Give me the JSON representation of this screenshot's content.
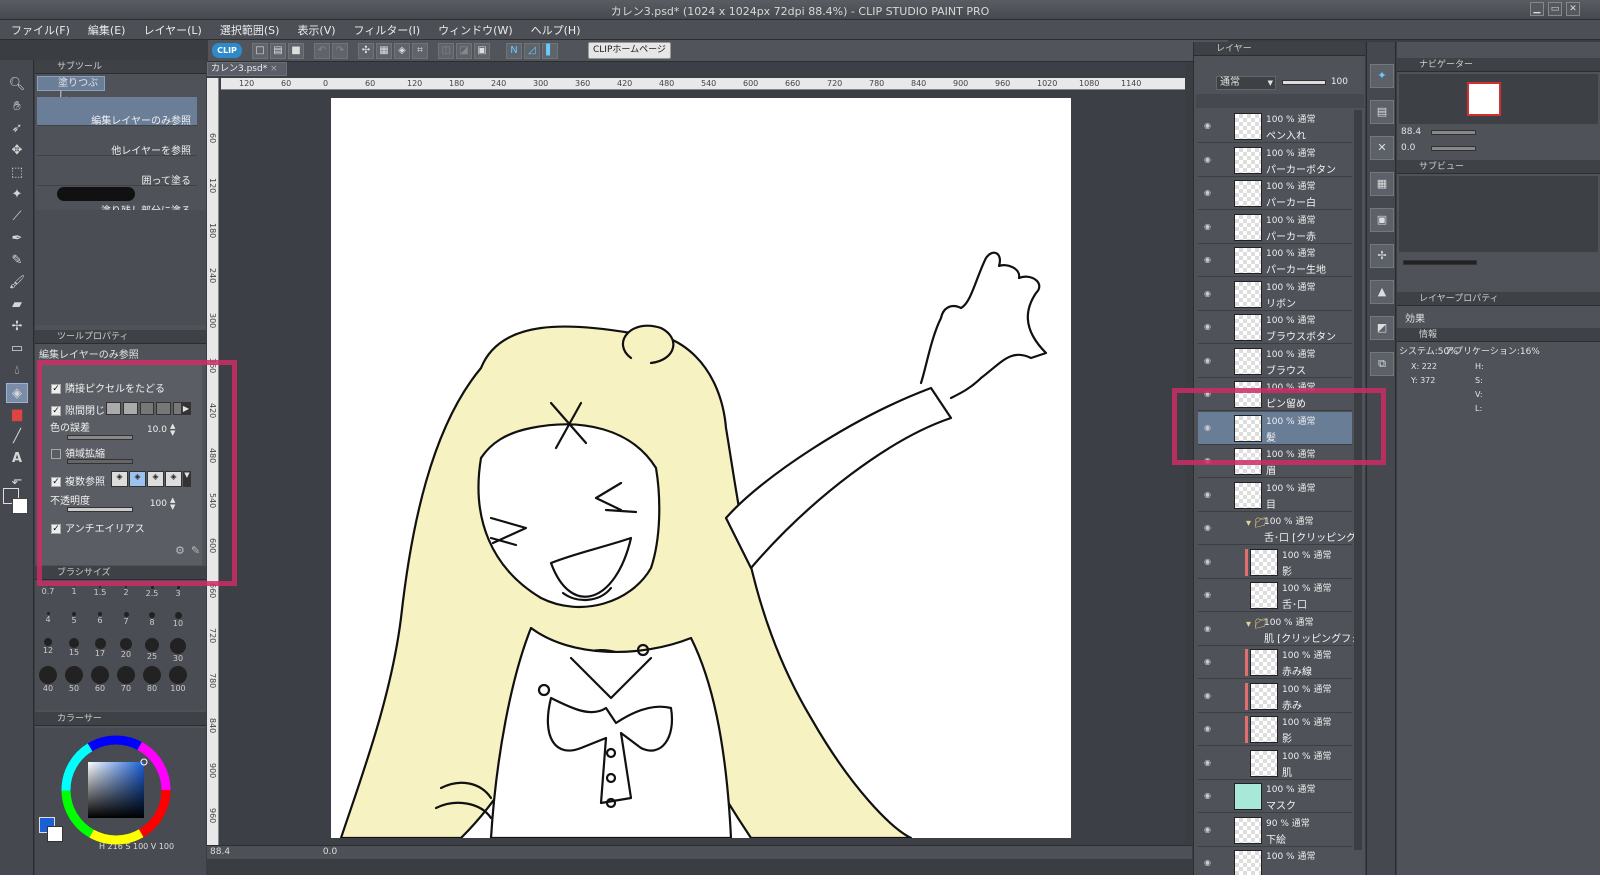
{
  "window": {
    "title": "カレン3.psd* (1024 x 1024px 72dpi 88.4%)  - CLIP STUDIO PAINT PRO"
  },
  "menu": [
    "ファイル(F)",
    "編集(E)",
    "レイヤー(L)",
    "選択範囲(S)",
    "表示(V)",
    "フィルター(I)",
    "ウィンドウ(W)",
    "ヘルプ(H)"
  ],
  "toolbar": {
    "logo": "CLIP",
    "home_button": "CLIPホームページ"
  },
  "subtool": {
    "tab": "サブツール",
    "group_label": "塗りつぶし",
    "items": [
      "編集レイヤーのみ参照",
      "他レイヤーを参照",
      "囲って塗る",
      "塗り残し部分に塗る"
    ]
  },
  "tool_property": {
    "tab": "ツールプロパティ",
    "title": "編集レイヤーのみ参照",
    "adjacent": "隣接ピクセルをたどる",
    "close_gap": "隙間閉じ",
    "color_margin": "色の誤差",
    "color_margin_value": "10.0",
    "area_scaling": "領域拡縮",
    "multi_ref": "複数参照",
    "opacity": "不透明度",
    "opacity_value": "100",
    "antialias": "アンチエイリアス"
  },
  "brush_size": {
    "tab": "ブラシサイズ",
    "sizes": [
      "0.7",
      "1",
      "1.5",
      "2",
      "2.5",
      "3",
      "4",
      "5",
      "6",
      "7",
      "8",
      "10",
      "12",
      "15",
      "17",
      "20",
      "25",
      "30",
      "40",
      "50",
      "60",
      "70",
      "80",
      "100"
    ]
  },
  "color": {
    "tab": "カラーサー",
    "hsv": "H 216  S 100  V 100",
    "main": "#1a5fd6",
    "sub": "#ffffff"
  },
  "document": {
    "tab": "カレン3.psd*",
    "zoom": "88.4",
    "angle": "0.0"
  },
  "ruler_h": [
    "120",
    "60",
    "0",
    "60",
    "120",
    "180",
    "240",
    "300",
    "360",
    "420",
    "480",
    "540",
    "600",
    "660",
    "720",
    "780",
    "840",
    "900",
    "960",
    "1020",
    "1080",
    "1140"
  ],
  "ruler_v": [
    "60",
    "120",
    "180",
    "240",
    "300",
    "360",
    "420",
    "480",
    "540",
    "600",
    "660",
    "720",
    "780",
    "840",
    "900",
    "960"
  ],
  "layer_panel": {
    "tab": "レイヤー",
    "blend": "通常",
    "opacity": "100",
    "layers": [
      {
        "pct": "100 %  通常",
        "name": "ペン入れ"
      },
      {
        "pct": "100 %  通常",
        "name": "パーカーボタン"
      },
      {
        "pct": "100 %  通常",
        "name": "パーカー白"
      },
      {
        "pct": "100 %  通常",
        "name": "パーカー赤"
      },
      {
        "pct": "100 %  通常",
        "name": "パーカー生地"
      },
      {
        "pct": "100 %  通常",
        "name": "リボン"
      },
      {
        "pct": "100 %  通常",
        "name": "ブラウスボタン"
      },
      {
        "pct": "100 %  通常",
        "name": "ブラウス"
      },
      {
        "pct": "100 %  通常",
        "name": "ピン留め"
      },
      {
        "pct": "100 %  通常",
        "name": "髪"
      },
      {
        "pct": "100 %  通常",
        "name": "眉"
      },
      {
        "pct": "100 %  通常",
        "name": "目"
      },
      {
        "pct": "100 %  通常",
        "name": "舌･口 [クリッピングフォル"
      },
      {
        "pct": "100 %  通常",
        "name": "影"
      },
      {
        "pct": "100 %  通常",
        "name": "舌･口"
      },
      {
        "pct": "100 %  通常",
        "name": "肌 [クリッピングフォルダ]"
      },
      {
        "pct": "100 %  通常",
        "name": "赤み線"
      },
      {
        "pct": "100 %  通常",
        "name": "赤み"
      },
      {
        "pct": "100 %  通常",
        "name": "影"
      },
      {
        "pct": "100 %  通常",
        "name": "肌"
      },
      {
        "pct": "100 %  通常",
        "name": "マスク"
      },
      {
        "pct": "90 %  通常",
        "name": "下絵"
      },
      {
        "pct": "100 %  通常",
        "name": ""
      }
    ]
  },
  "navigator": {
    "tab": "ナビゲーター",
    "zoom": "88.4",
    "angle": "0.0"
  },
  "subview": {
    "tab": "サブビュー"
  },
  "layer_property": {
    "tab": "レイヤープロパティ",
    "effect": "効果"
  },
  "info": {
    "tab": "情報",
    "system": "システム:50%",
    "app": "アプリケーション:16%",
    "x": "X: 222",
    "y": "Y: 372",
    "h": "H:",
    "s": "S:",
    "v": "V:",
    "l": "L:"
  },
  "colors": {
    "hair": "#f7f2c2",
    "highlight": "#cd2d64",
    "mask_thumb": "#a8e8d8"
  }
}
